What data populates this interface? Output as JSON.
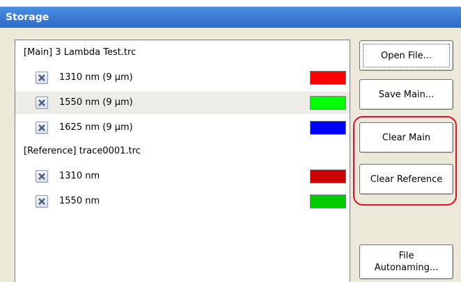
{
  "window": {
    "title": "Storage"
  },
  "main_group": {
    "header": "[Main] 3 Lambda Test.trc",
    "traces": [
      {
        "label": "1310 nm (9 µm)",
        "color": "#ff0000",
        "selected": false
      },
      {
        "label": "1550 nm (9 µm)",
        "color": "#00ff00",
        "selected": true
      },
      {
        "label": "1625 nm (9 µm)",
        "color": "#0000ff",
        "selected": false
      }
    ]
  },
  "reference_group": {
    "header": "[Reference] trace0001.trc",
    "traces": [
      {
        "label": "1310 nm",
        "color": "#cc0000"
      },
      {
        "label": "1550 nm",
        "color": "#00cc00"
      }
    ]
  },
  "buttons": {
    "open_file": "Open File...",
    "save_main": "Save Main...",
    "clear_main": "Clear Main",
    "clear_reference": "Clear Reference",
    "file_autonaming": "File\nAutonaming..."
  },
  "icons": {
    "remove": "x-icon"
  },
  "colors": {
    "title_bar": "#3a78d8",
    "background": "#ece9d8",
    "highlight": "#e0102a"
  }
}
